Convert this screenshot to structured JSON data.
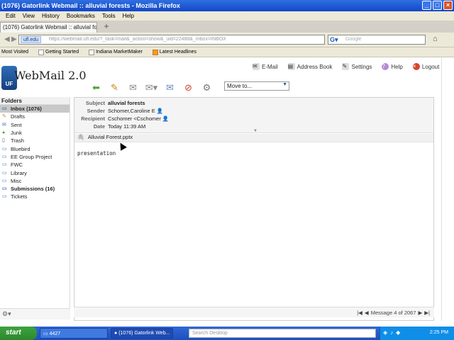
{
  "window": {
    "title": "(1076) Gatorlink Webmail :: alluvial forests - Mozilla Firefox"
  },
  "menu": [
    "Edit",
    "View",
    "History",
    "Bookmarks",
    "Tools",
    "Help"
  ],
  "tab": {
    "label": "(1076) Gatorlink Webmail :: alluvial forests"
  },
  "nav": {
    "site": "ufl.edu",
    "url": "https://webmail.ufl.edu/?_task=mail&_action=show&_uid=22488&_mbox=INBOX",
    "search_placeholder": "Google"
  },
  "bookmarks": [
    "Most Visited",
    "Getting Started",
    "Indiana MarketMaker",
    "Latest Headlines"
  ],
  "app": {
    "logo": "WebMail 2.0",
    "top_links": [
      "E-Mail",
      "Address Book",
      "Settings",
      "Help",
      "Logout"
    ],
    "move_to": "Move to..."
  },
  "folders": {
    "header": "Folders",
    "items": [
      {
        "label": "Inbox (1076)",
        "icon": "inbox-icon"
      },
      {
        "label": "Drafts",
        "icon": "drafts-icon"
      },
      {
        "label": "Sent",
        "icon": "sent-icon"
      },
      {
        "label": "Junk",
        "icon": "junk-icon"
      },
      {
        "label": "Trash",
        "icon": "trash-icon"
      },
      {
        "label": "Bluebird",
        "icon": "folder-icon"
      },
      {
        "label": "EE Group Project",
        "icon": "folder-icon"
      },
      {
        "label": "FWC",
        "icon": "folder-icon"
      },
      {
        "label": "Library",
        "icon": "folder-icon"
      },
      {
        "label": "Misc",
        "icon": "folder-icon"
      },
      {
        "label": "Submissions (16)",
        "icon": "folder-icon"
      },
      {
        "label": "Tickets",
        "icon": "folder-icon"
      }
    ]
  },
  "message": {
    "labels": {
      "subject": "Subject",
      "sender": "Sender",
      "recipient": "Recipient",
      "date": "Date"
    },
    "subject": "alluvial forests",
    "sender": "Schomer,Caroline E",
    "recipient": "Cschomer <Cschomer",
    "date": "Today 11:39 AM",
    "attachment": "Alluvial Forest.pptx",
    "body": "presentation"
  },
  "pager": {
    "text": "Message 4 of 2067"
  },
  "taskbar": {
    "start": "start",
    "tasks": [
      "4427",
      "(1076) Gatorlink Web..."
    ],
    "search_placeholder": "Search Desktop",
    "clock": "2:25 PM"
  }
}
